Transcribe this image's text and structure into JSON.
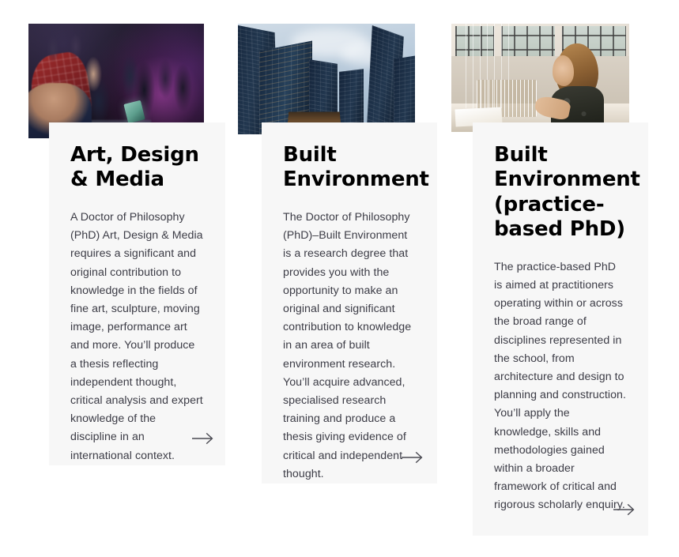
{
  "page": {
    "background_color": "#ffffff",
    "card_background_color": "#f7f7f7",
    "title_color": "#000000",
    "body_color": "#3c3c46",
    "arrow_color": "#4a4a52"
  },
  "cards": [
    {
      "id": "art-design-media",
      "title": "Art, Design & Media",
      "body": "A Doctor of Philosophy (PhD) Art, Design & Media requires a significant and original contribution to knowledge in the fields of fine art, sculpture, moving image, performance art and more. You’ll produce a thesis reflecting independent thought, critical analysis and expert knowledge of the discipline in an international context.",
      "image_alt": "People gathered at a dark media arts event with magenta stage lighting",
      "arrow_label": "arrow-right-icon"
    },
    {
      "id": "built-environment",
      "title": "Built Environment",
      "body": "The Doctor of Philosophy (PhD)–Built Environment is a research degree that provides you with the opportunity to make an original and significant contribution to knowledge in an area of built environment research. You’ll acquire advanced, specialised research training and produce a thesis giving evidence of critical and independent thought.",
      "image_alt": "Glass skyscrapers photographed looking upward against a pale blue sky",
      "arrow_label": "arrow-right-icon"
    },
    {
      "id": "built-environment-practice-based",
      "title": "Built Environment (practice-based PhD)",
      "body": "The practice-based PhD is aimed at practitioners operating within or across the broad range of disciplines represented in the school, from architecture and design to planning and construction. You’ll apply the knowledge, skills and methodologies gained within a broader framework of critical and rigorous scholarly enquiry.",
      "image_alt": "A woman working on a white architectural model in a studio",
      "arrow_label": "arrow-right-icon"
    }
  ]
}
